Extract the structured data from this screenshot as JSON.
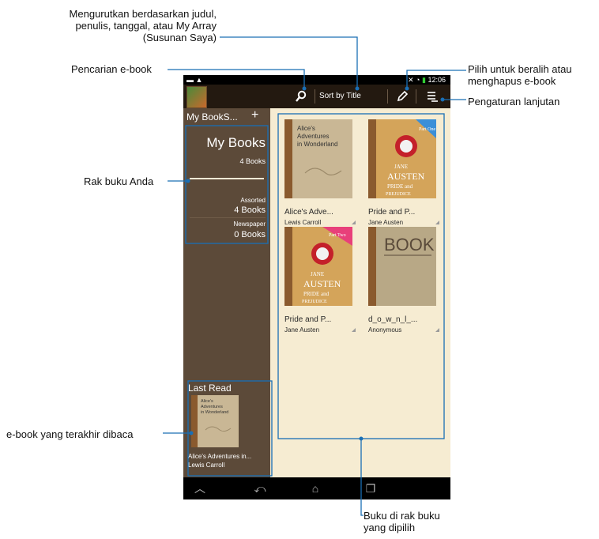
{
  "callouts": {
    "sort": "Mengurutkan berdasarkan judul, penulis, tanggal, atau My Array (Susunan Saya)",
    "search": "Pencarian e-book",
    "select": "Pilih untuk beralih atau menghapus e-book",
    "advanced": "Pengaturan lanjutan",
    "bookshelf": "Rak buku Anda",
    "last_read": "e-book yang terakhir dibaca",
    "books_in_shelf": "Buku di rak buku yang dipilih"
  },
  "status_bar": {
    "time": "12:06"
  },
  "action_bar": {
    "sort_label": "Sort by Title",
    "search_icon": "magnifier",
    "edit_icon": "pencil",
    "menu_icon": "list-menu"
  },
  "sidebar": {
    "title": "My BookS...",
    "add_icon": "plus",
    "shelf": {
      "name": "My Books",
      "count": "4 Books",
      "categories": [
        {
          "name": "Assorted",
          "count": "4 Books"
        },
        {
          "name": "Newspaper",
          "count": "0 Books"
        }
      ]
    },
    "last_read": {
      "title": "Last Read",
      "book_title": "Alice's Adventures in...",
      "author": "Lewis Carroll",
      "cover_text": [
        "Alice's",
        "Adventures",
        "in Wonderland"
      ]
    }
  },
  "books": [
    {
      "title": "Alice's Adve...",
      "author": "Lewis Carroll",
      "cover": [
        "Alice's",
        "Adventures",
        "in Wonderland"
      ]
    },
    {
      "title": "Pride and P...",
      "author": "Jane Austen",
      "cover": [
        "Part One",
        "JANE",
        "AUSTEN",
        "PRIDE and",
        "PREJUDICE"
      ]
    },
    {
      "title": "Pride and P...",
      "author": "Jane Austen",
      "cover": [
        "Part Two",
        "JANE",
        "AUSTEN",
        "PRIDE and",
        "PREJUDICE"
      ]
    },
    {
      "title": "d_o_w_n_l_...",
      "author": "Anonymous",
      "cover": [
        "BOOK"
      ]
    }
  ],
  "colors": {
    "sidebar": "#5c4a39",
    "content": "#f6ecd2",
    "callout_line": "#1a6fb5"
  }
}
